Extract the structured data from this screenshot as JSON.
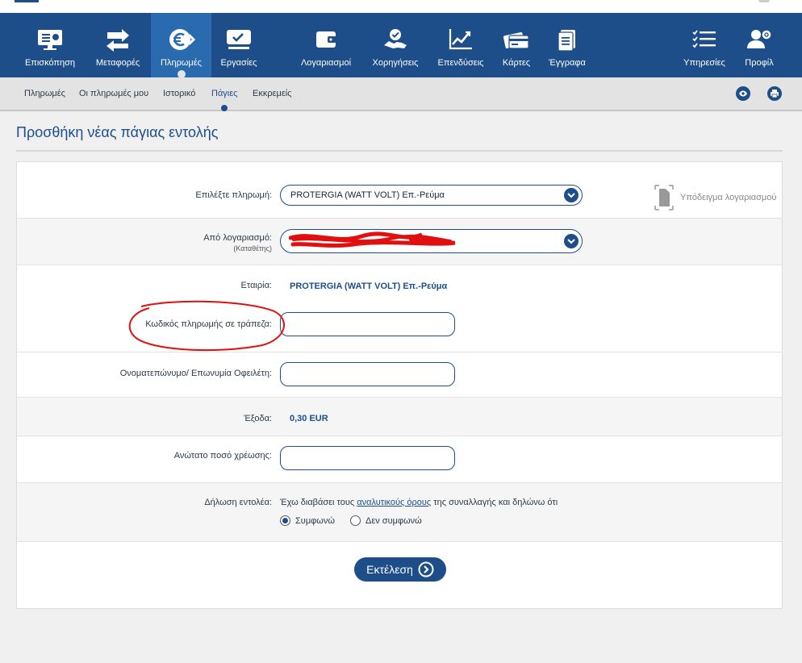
{
  "nav": {
    "items": [
      {
        "label": "Επισκόπηση",
        "icon": "overview-icon"
      },
      {
        "label": "Μεταφορές",
        "icon": "transfers-icon"
      },
      {
        "label": "Πληρωμές",
        "icon": "payments-euro-icon"
      },
      {
        "label": "Εργασίες",
        "icon": "tasks-icon"
      },
      {
        "label": "Λογαριασμοί",
        "icon": "wallet-icon"
      },
      {
        "label": "Χορηγήσεις",
        "icon": "loans-handshake-icon"
      },
      {
        "label": "Επενδύσεις",
        "icon": "investments-chart-icon"
      },
      {
        "label": "Κάρτες",
        "icon": "cards-icon"
      },
      {
        "label": "Έγγραφα",
        "icon": "documents-icon"
      },
      {
        "label": "Υπηρεσίες",
        "icon": "services-list-icon"
      },
      {
        "label": "Προφίλ",
        "icon": "profile-gear-icon"
      }
    ],
    "active": "Πληρωμές"
  },
  "subnav": {
    "items": [
      "Πληρωμές",
      "Οι πληρωμές μου",
      "Ιστορικό",
      "Πάγιες",
      "Εκκρεμείς"
    ],
    "active": "Πάγιες"
  },
  "page": {
    "title": "Προσθήκη νέας πάγιας εντολής"
  },
  "form": {
    "payment_label": "Επιλέξτε πληρωμή:",
    "payment_value": "PROTERGIA (WATT VOLT) Επ.-Ρεύμα",
    "sample_label": "Υπόδειγμα λογαριασμού",
    "account_label": "Από λογαριασμό:",
    "account_sublabel": "(Καταθέτης)",
    "company_label": "Εταιρία:",
    "company_value": "PROTERGIA (WATT VOLT) Επ.-Ρεύμα",
    "code_label": "Κωδικός πληρωμής σε τράπεζα:",
    "code_value": "",
    "name_label": "Ονοματεπώνυμο/ Επωνυμία Οφειλέτη:",
    "name_value": "",
    "fee_label": "Έξοδα:",
    "fee_value": "0,30  EUR",
    "max_label": "Ανώτατο ποσό χρέωσης:",
    "max_value": "",
    "decl_label": "Δήλωση εντολέα:",
    "decl_text_pre": "Έχω διαβάσει τους ",
    "decl_link": "αναλυτικούς όρους",
    "decl_text_post": " της συναλλαγής και δηλώνω ότι",
    "radio_agree": "Συμφωνώ",
    "radio_disagree": "Δεν συμφωνώ",
    "agree_selected": true,
    "submit_label": "Εκτέλεση"
  },
  "colors": {
    "brand": "#1d4e89",
    "active_tab": "#2a6aaf",
    "annotation": "#e01010"
  }
}
